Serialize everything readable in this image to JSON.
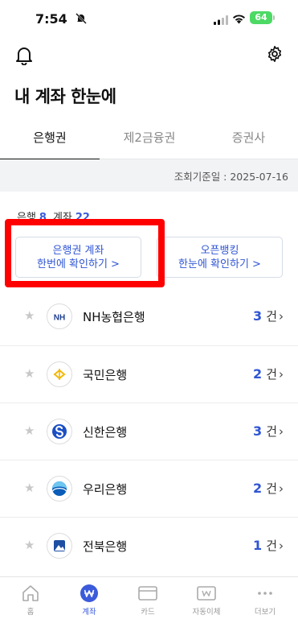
{
  "status_bar": {
    "time": "7:54",
    "battery": "64"
  },
  "header": {
    "title": "내 계좌 한눈에"
  },
  "tabs": [
    {
      "label": "은행권",
      "active": true
    },
    {
      "label": "제2금융권",
      "active": false
    },
    {
      "label": "증권사",
      "active": false
    }
  ],
  "query_date": "조회기준일 : 2025-07-16",
  "summary": {
    "bank_label": "은행",
    "bank_count": "8",
    "account_label": "계좌",
    "account_count": "22"
  },
  "shortcuts": [
    {
      "line1": "은행권 계좌",
      "line2": "한번에 확인하기 >"
    },
    {
      "line1": "오픈뱅킹",
      "line2": "한눈에 확인하기 >"
    }
  ],
  "banks": [
    {
      "name": "NH농협은행",
      "count": "3",
      "unit": "건",
      "icon": "nh-bank-logo-icon"
    },
    {
      "name": "국민은행",
      "count": "2",
      "unit": "건",
      "icon": "kb-bank-logo-icon"
    },
    {
      "name": "신한은행",
      "count": "3",
      "unit": "건",
      "icon": "shinhan-bank-logo-icon"
    },
    {
      "name": "우리은행",
      "count": "2",
      "unit": "건",
      "icon": "woori-bank-logo-icon"
    },
    {
      "name": "전북은행",
      "count": "1",
      "unit": "건",
      "icon": "jb-bank-logo-icon"
    }
  ],
  "nav": [
    {
      "label": "홈",
      "icon": "home-icon"
    },
    {
      "label": "계좌",
      "icon": "account-won-icon",
      "active": true
    },
    {
      "label": "카드",
      "icon": "card-icon"
    },
    {
      "label": "자동이체",
      "icon": "auto-transfer-icon"
    },
    {
      "label": "더보기",
      "icon": "more-dots-icon"
    }
  ],
  "colors": {
    "accent": "#3b5bdb",
    "highlight": "#ff0000"
  }
}
